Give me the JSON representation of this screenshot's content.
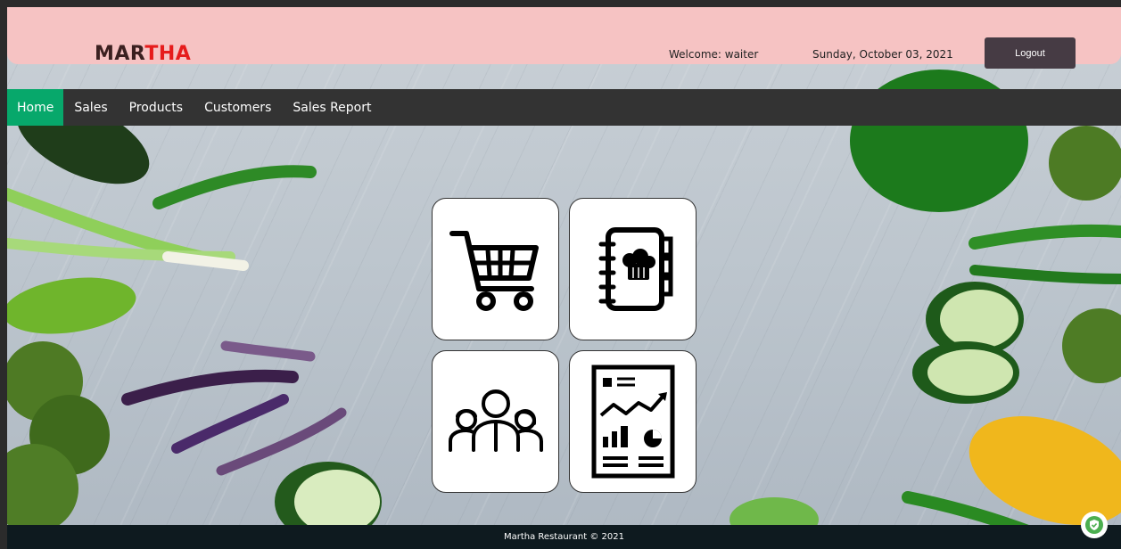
{
  "header": {
    "logo_part1": "MAR",
    "logo_part2": "THA",
    "welcome": "Welcome: waiter",
    "date": "Sunday, October 03, 2021",
    "logout_label": "Logout"
  },
  "nav": {
    "items": [
      {
        "label": "Home",
        "active": true
      },
      {
        "label": "Sales"
      },
      {
        "label": "Products"
      },
      {
        "label": "Customers"
      },
      {
        "label": "Sales Report"
      }
    ]
  },
  "tiles": [
    {
      "icon": "shopping-cart-icon"
    },
    {
      "icon": "chef-notebook-icon"
    },
    {
      "icon": "people-group-icon"
    },
    {
      "icon": "report-chart-icon"
    }
  ],
  "footer": {
    "text": "Martha Restaurant © 2021"
  },
  "colors": {
    "header_bg": "#f6c3c3",
    "nav_bg": "#333333",
    "nav_active": "#07a86b",
    "logout_bg": "#463b44",
    "footer_bg": "#0e1a1f",
    "logo_accent": "#e61c1c"
  }
}
